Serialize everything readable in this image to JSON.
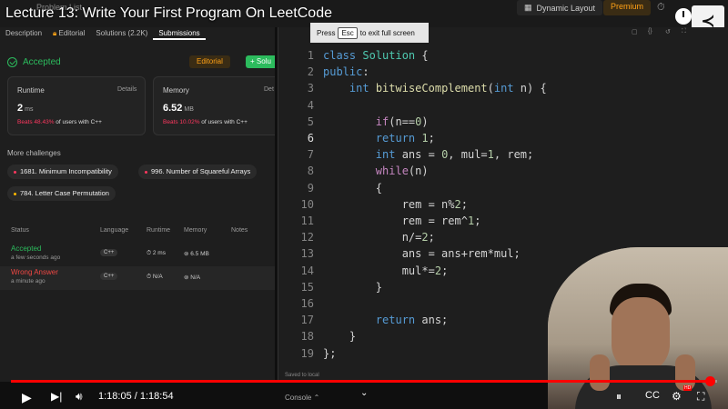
{
  "video": {
    "title": "Lecture 13: Write Your First Program On LeetCode",
    "time_current": "1:18:05",
    "time_separator": " / ",
    "time_total": "1:18:54",
    "progress_fraction": 0.9896
  },
  "topbar": {
    "problem_list": "Problem List",
    "dynamic_layout": "Dynamic Layout",
    "premium": "Premium"
  },
  "fullscreen_notice": {
    "prefix": "Press",
    "key": "Esc",
    "suffix": "to exit full screen"
  },
  "left_tabs": [
    {
      "label": "Description",
      "active": false
    },
    {
      "label": "Editorial",
      "active": false
    },
    {
      "label": "Solutions (2.2K)",
      "active": false
    },
    {
      "label": "Submissions",
      "active": true
    }
  ],
  "result": {
    "status": "Accepted",
    "editorial_button": "Editorial",
    "solution_button": "+ Solu"
  },
  "runtime": {
    "label": "Runtime",
    "details": "Details",
    "value": "2",
    "unit": "ms",
    "beats_pct": "Beats 48.43%",
    "beats_suffix": "of users with C++"
  },
  "memory": {
    "label": "Memory",
    "details": "Det",
    "value": "6.52",
    "unit": "MB",
    "beats_pct": "Beats 10.02%",
    "beats_suffix": "of users with C++"
  },
  "more_challenges": {
    "heading": "More challenges",
    "items": [
      {
        "label": "1681. Minimum Incompatibility",
        "dot": "#ff375f"
      },
      {
        "label": "996. Number of Squareful Arrays",
        "dot": "#ff375f"
      },
      {
        "label": "784. Letter Case Permutation",
        "dot": "#ffb800"
      }
    ]
  },
  "submissions": {
    "headers": [
      "Status",
      "Language",
      "Runtime",
      "Memory",
      "Notes"
    ],
    "rows": [
      {
        "status": "Accepted",
        "status_color": "#2cbb5d",
        "time": "a few seconds ago",
        "language": "C++",
        "runtime": "2 ms",
        "memory": "6.5 MB"
      },
      {
        "status": "Wrong Answer",
        "status_color": "#ef4743",
        "time": "a minute ago",
        "language": "C++",
        "runtime": "N/A",
        "memory": "N/A"
      }
    ]
  },
  "editor": {
    "saved": "Saved to local",
    "console": "Console",
    "current_line": 6,
    "line_numbers": [
      "1",
      "2",
      "3",
      "4",
      "5",
      "6",
      "7",
      "8",
      "9",
      "10",
      "11",
      "12",
      "13",
      "14",
      "15",
      "16",
      "17",
      "18",
      "19"
    ],
    "lines": [
      "class Solution {",
      "public:",
      "    int bitwiseComplement(int n) {",
      "",
      "        if(n==0)",
      "        return 1;",
      "        int ans = 0, mul=1, rem;",
      "        while(n)",
      "        {",
      "            rem = n%2;",
      "            rem = rem^1;",
      "            n/=2;",
      "            ans = ans+rem*mul;",
      "            mul*=2;",
      "        }",
      "",
      "        return ans;",
      "    }",
      "};"
    ]
  },
  "colors": {
    "accepted": "#2cbb5d",
    "wrong": "#ef4743",
    "progress": "#ff0000",
    "keyword": "#569cd6",
    "control": "#c586c0",
    "type_name": "#4ec9b0",
    "function": "#dcdcaa",
    "number": "#b5cea8"
  }
}
